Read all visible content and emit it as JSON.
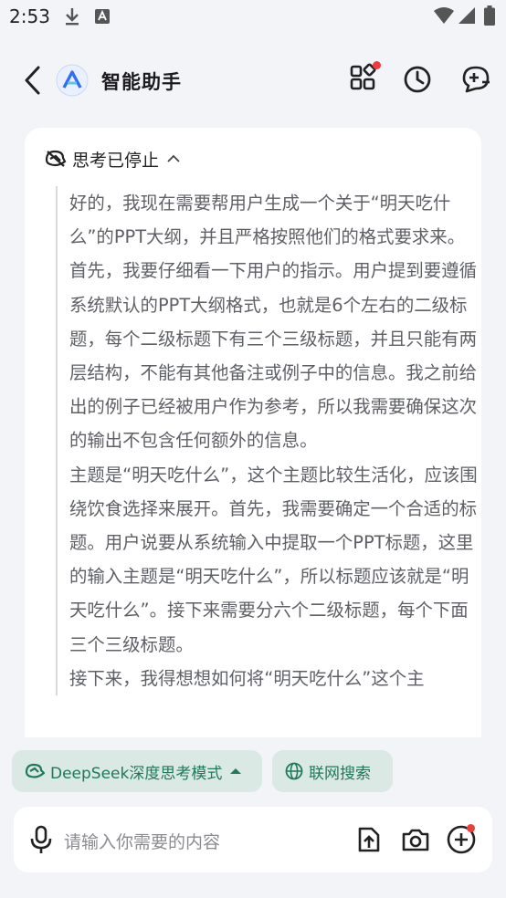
{
  "status_bar": {
    "time": "2:53",
    "icons": [
      "download-icon",
      "app-notification-icon",
      "wifi-icon",
      "cellular-signal-icon",
      "battery-icon"
    ]
  },
  "header": {
    "title": "智能助手",
    "icons": [
      "back-icon",
      "assistant-logo-icon",
      "apps-grid-icon",
      "history-clock-icon",
      "new-chat-icon"
    ]
  },
  "thinking": {
    "label": "思考已停止",
    "paragraphs": [
      "好的，我现在需要帮用户生成一个关于“明天吃什么”的PPT大纲，并且严格按照他们的格式要求来。首先，我要仔细看一下用户的指示。用户提到要遵循系统默认的PPT大纲格式，也就是6个左右的二级标题，每个二级标题下有三个三级标题，并且只能有两层结构，不能有其他备注或例子中的信息。我之前给出的例子已经被用户作为参考，所以我需要确保这次的输出不包含任何额外的信息。",
      "主题是“明天吃什么”，这个主题比较生活化，应该围绕饮食选择来展开。首先，我需要确定一个合适的标题。用户说要从系统输入中提取一个PPT标题，这里的输入主题是“明天吃什么”，所以标题应该就是“明天吃什么”。接下来需要分六个二级标题，每个下面三个三级标题。",
      "接下来，我得想想如何将“明天吃什么”这个主"
    ]
  },
  "modes": {
    "deep_think_label": "DeepSeek深度思考模式",
    "web_search_label": "联网搜索"
  },
  "input": {
    "placeholder": "请输入你需要的内容"
  },
  "colors": {
    "accent_green": "#1e7a5a",
    "chip_bg": "#dbe9e5",
    "notification_red": "#f23b3b",
    "logo_blue": "#2f6ff0"
  }
}
